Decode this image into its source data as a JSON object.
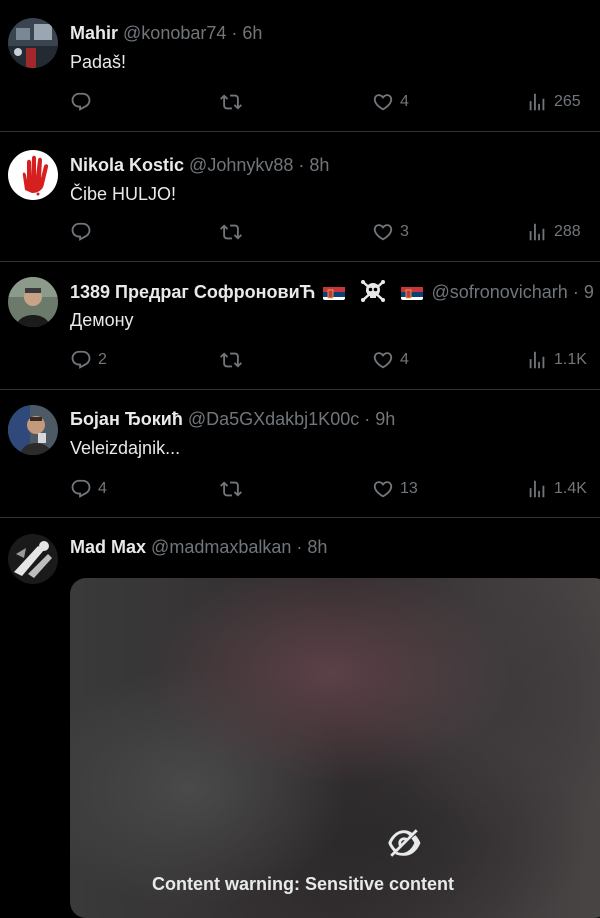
{
  "tweets": [
    {
      "name": "Mahir",
      "handle": "@konobar74",
      "dot": "·",
      "time": "6h",
      "text": "Padaš!",
      "reply": "",
      "retweet": "",
      "like": "4",
      "views": "265"
    },
    {
      "name": "Nikola Kostic",
      "handle": "@Johnykv88",
      "dot": "·",
      "time": "8h",
      "text": "Čibe HULJO!",
      "reply": "",
      "retweet": "",
      "like": "3",
      "views": "288"
    },
    {
      "name": "1389 Предраг СофроновиЋ",
      "handle": "@sofronovicharh",
      "dot": "·",
      "time": "9",
      "text": "Демону",
      "reply": "2",
      "retweet": "",
      "like": "4",
      "views": "1.1K"
    },
    {
      "name": "Бојан Ђокић",
      "handle": "@Da5GXdakbj1K00c",
      "dot": "·",
      "time": "9h",
      "text": "Veleizdajnik...",
      "reply": "4",
      "retweet": "",
      "like": "13",
      "views": "1.4K"
    },
    {
      "name": "Mad Max",
      "handle": "@madmaxbalkan",
      "dot": "·",
      "time": "8h",
      "media_warning": "Content warning: Sensitive content"
    }
  ],
  "icons": {
    "reply": "reply-icon",
    "retweet": "retweet-icon",
    "like": "heart-icon",
    "views": "views-icon",
    "hidden": "eye-slash-icon"
  },
  "colors": {
    "background": "#000000",
    "text": "#e7e9ea",
    "muted": "#71767b",
    "divider": "#2f3336"
  }
}
